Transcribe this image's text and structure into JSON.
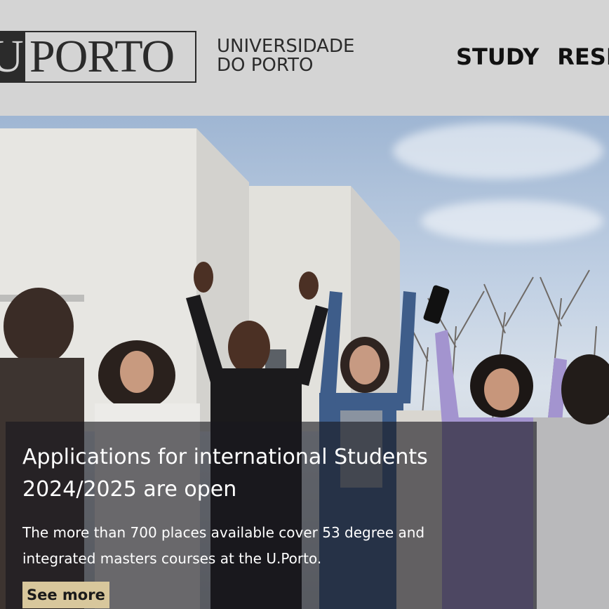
{
  "header": {
    "logo_mark": "U.",
    "logo_text": "PORTO",
    "university_line1": "UNIVERSIDADE",
    "university_line2": "DO PORTO"
  },
  "nav": {
    "items": [
      {
        "label": "STUDY"
      },
      {
        "label": "RESEA"
      }
    ]
  },
  "hero": {
    "headline_line1": "Applications for international Students",
    "headline_line2": "2024/2025 are open",
    "summary_line1": "The more than 700 places available cover 53 degree and",
    "summary_line2": "integrated masters courses at the U.Porto.",
    "cta_label": "See more"
  },
  "colors": {
    "header_bg": "#d4d4d4",
    "logo_dark": "#2b2b2b",
    "cta_bg": "#d8c79c",
    "overlay": "rgba(25,25,30,0.62)"
  }
}
